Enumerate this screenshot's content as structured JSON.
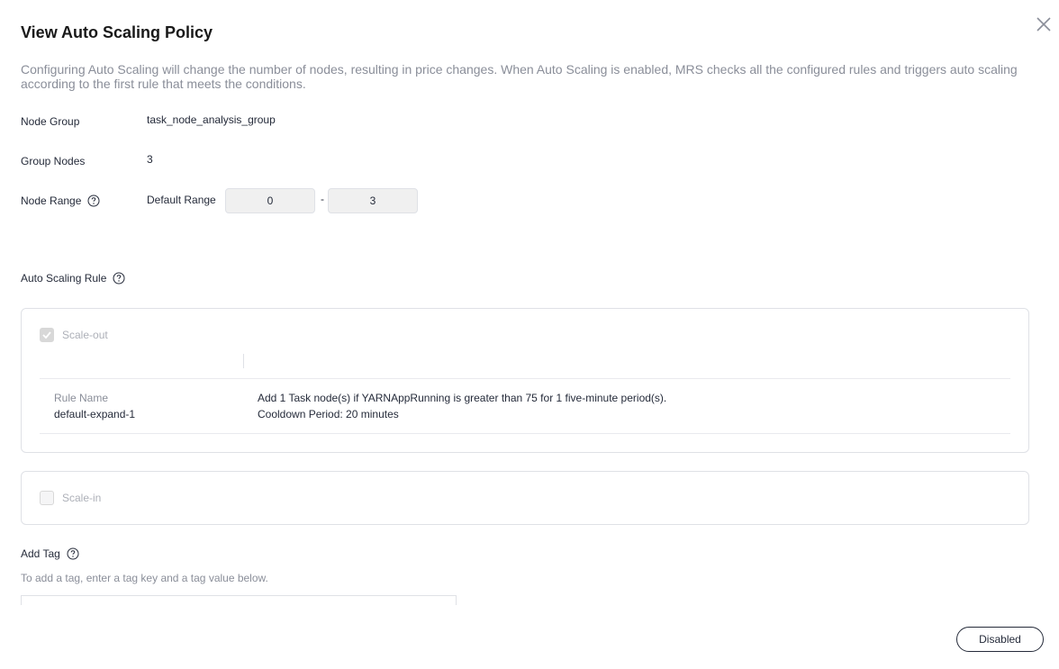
{
  "dialog": {
    "title": "View Auto Scaling Policy",
    "notice": "Configuring Auto Scaling will change the number of nodes, resulting in price changes. When Auto Scaling is enabled, MRS checks all the configured rules and triggers auto scaling according to the first rule that meets the conditions."
  },
  "fields": {
    "node_group_label": "Node Group",
    "node_group_value": "task_node_analysis_group",
    "group_nodes_label": "Group Nodes",
    "group_nodes_value": "3",
    "node_range_label": "Node Range",
    "default_range_label": "Default Range",
    "range_min": "0",
    "range_separator": "-",
    "range_max": "3"
  },
  "auto_scaling": {
    "label": "Auto Scaling Rule",
    "scale_out": {
      "label": "Scale-out",
      "checked": true,
      "rule_name_header": "Rule Name",
      "rule_name": "default-expand-1",
      "rule_desc": "Add 1 Task node(s) if YARNAppRunning is greater than 75 for 1 five-minute period(s).",
      "cooldown": "Cooldown Period: 20 minutes"
    },
    "scale_in": {
      "label": "Scale-in",
      "checked": false
    }
  },
  "tags": {
    "label": "Add Tag",
    "hint": "To add a tag, enter a tag key and a tag value below."
  },
  "footer": {
    "button_label": "Disabled"
  },
  "icons": {
    "close": "close-icon",
    "help": "help-circle-icon",
    "check": "check-icon"
  }
}
